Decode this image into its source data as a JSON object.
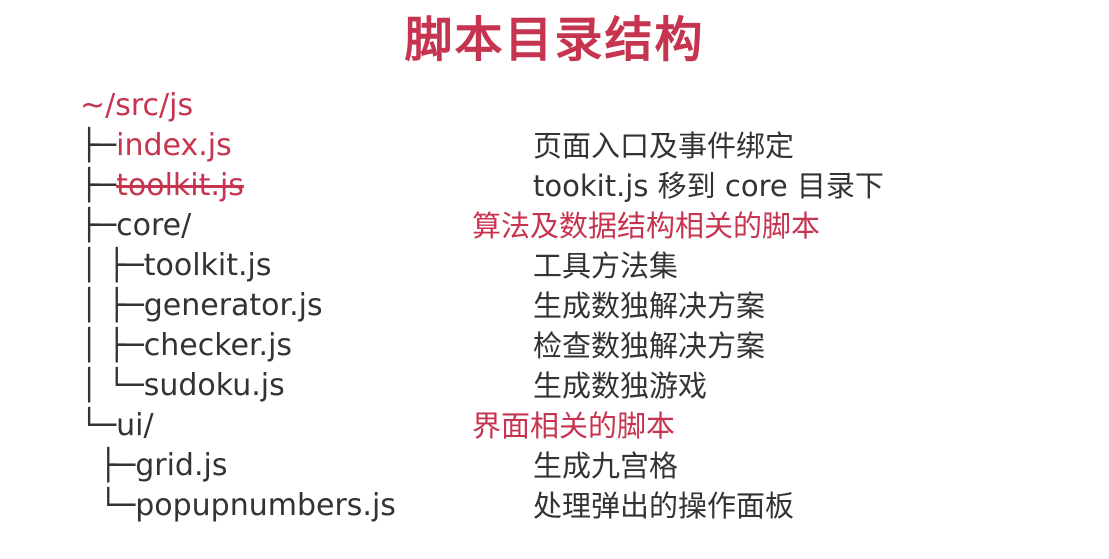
{
  "title": "脚本目录结构",
  "colors": {
    "accent": "#c7344f",
    "text": "#333333",
    "background": "#ffffff"
  },
  "tree": [
    {
      "prefix": "",
      "name": "~/src/js",
      "name_style": "red",
      "desc": "",
      "desc_style": "normal"
    },
    {
      "prefix": "├─",
      "name": "index.js",
      "name_style": "red",
      "desc": "页面入口及事件绑定",
      "desc_style": "normal"
    },
    {
      "prefix": "├─",
      "name": "toolkit.js",
      "name_style": "red-strike",
      "desc": "tookit.js 移到 core 目录下",
      "desc_style": "normal"
    },
    {
      "prefix": "├─",
      "name": "core/",
      "name_style": "normal",
      "desc": "算法及数据结构相关的脚本",
      "desc_style": "red"
    },
    {
      "prefix": "│ ├─",
      "name": "toolkit.js",
      "name_style": "normal",
      "desc": "工具方法集",
      "desc_style": "normal"
    },
    {
      "prefix": "│ ├─",
      "name": "generator.js",
      "name_style": "normal",
      "desc": "生成数独解决方案",
      "desc_style": "normal"
    },
    {
      "prefix": "│ ├─",
      "name": "checker.js",
      "name_style": "normal",
      "desc": "检查数独解决方案",
      "desc_style": "normal"
    },
    {
      "prefix": "│ └─",
      "name": "sudoku.js",
      "name_style": "normal",
      "desc": "生成数独游戏",
      "desc_style": "normal"
    },
    {
      "prefix": "└─",
      "name": "ui/",
      "name_style": "normal",
      "desc": "界面相关的脚本",
      "desc_style": "red"
    },
    {
      "prefix": "  ├─",
      "name": "grid.js",
      "name_style": "normal",
      "desc": "生成九宫格",
      "desc_style": "normal"
    },
    {
      "prefix": "  └─",
      "name": "popupnumbers.js",
      "name_style": "normal",
      "desc": "处理弹出的操作面板",
      "desc_style": "normal"
    }
  ]
}
